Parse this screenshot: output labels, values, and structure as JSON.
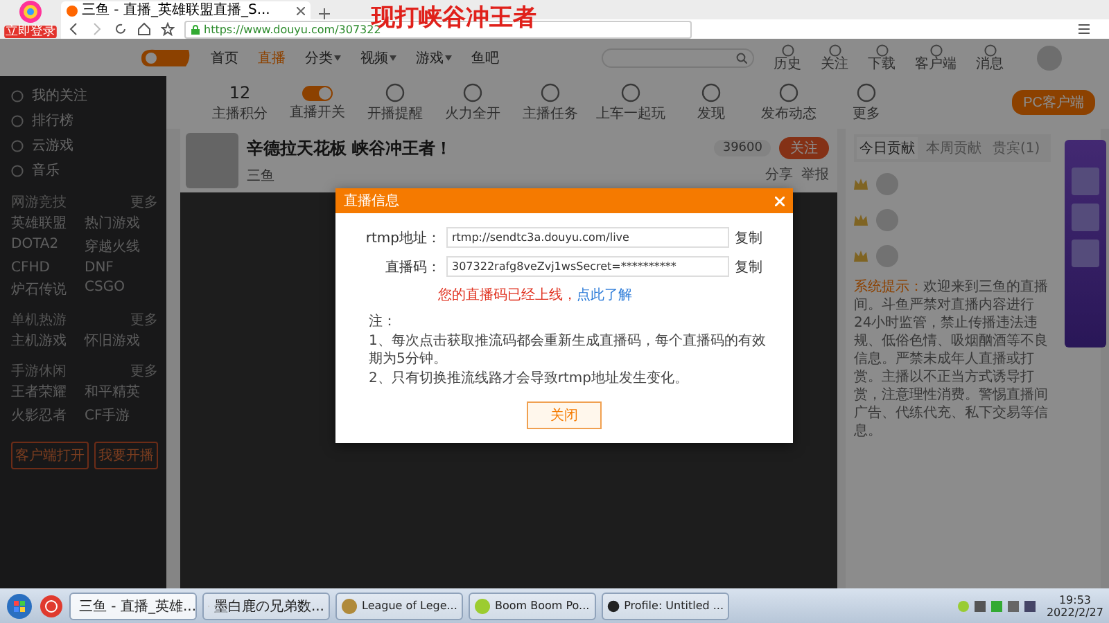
{
  "browser": {
    "login_badge": "立即登录",
    "tab_title": "三鱼 - 直播_英雄联盟直播_S...",
    "url": "https://www.douyu.com/307322",
    "overlay_caption": "现打峡谷冲王者"
  },
  "header": {
    "nav": [
      {
        "label": "首页",
        "selected": false,
        "menu": false
      },
      {
        "label": "直播",
        "selected": true,
        "menu": false
      },
      {
        "label": "分类",
        "selected": false,
        "menu": true
      },
      {
        "label": "视频",
        "selected": false,
        "menu": true
      },
      {
        "label": "游戏",
        "selected": false,
        "menu": true
      },
      {
        "label": "鱼吧",
        "selected": false,
        "menu": false
      }
    ],
    "user_links": [
      "历史",
      "关注",
      "下载",
      "客户端",
      "消息"
    ]
  },
  "sidebar": {
    "links": [
      "我的关注",
      "排行榜",
      "云游戏",
      "音乐"
    ],
    "sections": [
      {
        "title": "网游竞技",
        "more": "更多",
        "games": [
          "英雄联盟",
          "热门游戏",
          "DOTA2",
          "穿越火线",
          "CFHD",
          "DNF",
          "炉石传说",
          "CSGO"
        ]
      },
      {
        "title": "单机热游",
        "more": "更多",
        "games": [
          "主机游戏",
          "怀旧游戏"
        ]
      },
      {
        "title": "手游休闲",
        "more": "更多",
        "games": [
          "王者荣耀",
          "和平精英",
          "火影忍者",
          "CF手游"
        ]
      }
    ],
    "buttons": [
      "客户端打开",
      "我要开播"
    ]
  },
  "toolbar": {
    "items": [
      {
        "kind": "count",
        "value": "12",
        "label": "主播积分"
      },
      {
        "kind": "toggle",
        "on": true,
        "label": "直播开关"
      },
      {
        "kind": "icon",
        "label": "开播提醒"
      },
      {
        "kind": "icon",
        "label": "火力全开"
      },
      {
        "kind": "icon",
        "label": "主播任务"
      },
      {
        "kind": "icon",
        "label": "上车一起玩"
      },
      {
        "kind": "icon",
        "label": "发现"
      },
      {
        "kind": "icon",
        "label": "发布动态"
      },
      {
        "kind": "icon",
        "label": "更多"
      }
    ],
    "client_button": "PC客户端"
  },
  "room": {
    "title": "辛德拉天花板 峡谷冲王者！",
    "anchor": "三鱼",
    "followers": "39600",
    "follow_button": "关注",
    "actions": [
      "分享",
      "举报"
    ]
  },
  "dialog": {
    "title": "直播信息",
    "fields": [
      {
        "label": "rtmp地址：",
        "value": "rtmp://sendtc3a.douyu.com/live",
        "copy": "复制"
      },
      {
        "label": "直播码：",
        "value": "307322rafg8veZvj1wsSecret=**********",
        "copy": "复制"
      }
    ],
    "warning": "您的直播码已经上线，",
    "warning_link": "点此了解",
    "note_title": "注：",
    "notes": [
      "1、每次点击获取推流码都会重新生成直播码，每个直播码的有效期为5分钟。",
      "2、只有切换推流线路才会导致rtmp地址发生变化。"
    ],
    "close_button": "关闭"
  },
  "right_panel": {
    "tabs": [
      {
        "label": "今日贡献",
        "selected": true
      },
      {
        "label": "本周贡献",
        "selected": false
      },
      {
        "label": "贵宾(1)",
        "selected": false
      }
    ],
    "notice_label": "系统提示：",
    "notice": "欢迎来到三鱼的直播间。斗鱼严禁对直播内容进行24小时监管，禁止传播违法违规、低俗色情、吸烟酗酒等不良信息。严禁未成年人直播或打赏。主播以不正当方式诱导打赏，注意理性消费。警惕直播间广告、代练代充、私下交易等信息。"
  },
  "taskbar": {
    "tasks": [
      {
        "label": "三鱼 - 直播_英雄...",
        "selected": true
      },
      {
        "label": "墨白鹿の兄弟数...",
        "selected": false
      },
      {
        "label": "League of Lege...",
        "selected": false
      },
      {
        "label": "Boom Boom Po...",
        "selected": false
      },
      {
        "label": "Profile: Untitled ...",
        "selected": false
      }
    ],
    "time": "19:53",
    "date": "2022/2/27"
  }
}
